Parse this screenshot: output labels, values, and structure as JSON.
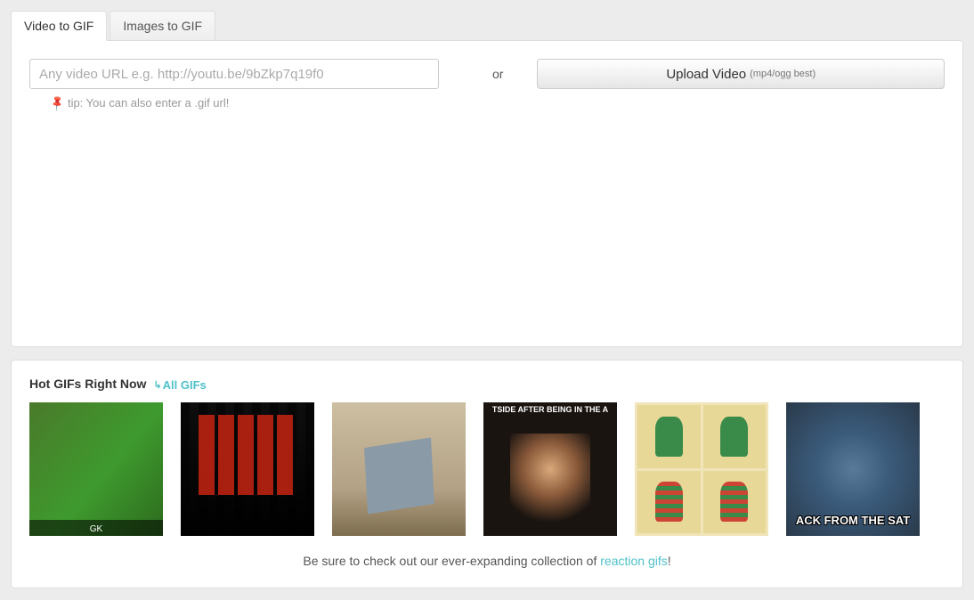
{
  "tabs": {
    "video": "Video to GIF",
    "images": "Images to GIF"
  },
  "main": {
    "url_placeholder": "Any video URL e.g. http://youtu.be/9bZkp7q19f0",
    "or_text": "or",
    "upload_label": "Upload Video",
    "upload_hint": "(mp4/ogg best)",
    "tip_text": "tip: You can also enter a .gif url!"
  },
  "hot": {
    "title": "Hot GIFs Right Now",
    "all_link": "All GIFs",
    "footer_pre": "Be sure to check out our ever-expanding collection of ",
    "footer_link": "reaction gifs",
    "footer_post": "!"
  }
}
